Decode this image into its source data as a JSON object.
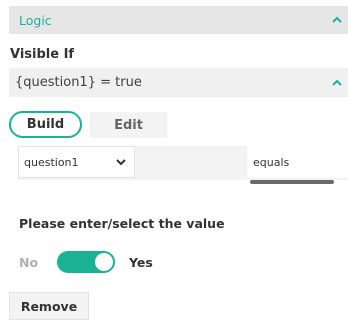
{
  "logic": {
    "title": "Logic"
  },
  "visible_if": {
    "label": "Visible If",
    "expression": "{question1} = true"
  },
  "tabs": {
    "build": "Build",
    "edit": "Edit"
  },
  "condition": {
    "question": "question1",
    "operator": "equals"
  },
  "value": {
    "prompt": "Please enter/select the value",
    "no": "No",
    "yes": "Yes",
    "toggle_on": true
  },
  "actions": {
    "remove": "Remove"
  },
  "colors": {
    "accent": "#19b394",
    "panel_bg": "#e6e6e6"
  },
  "icons": {
    "collapse": "chevron-up-icon",
    "dropdown": "chevron-down-icon"
  }
}
